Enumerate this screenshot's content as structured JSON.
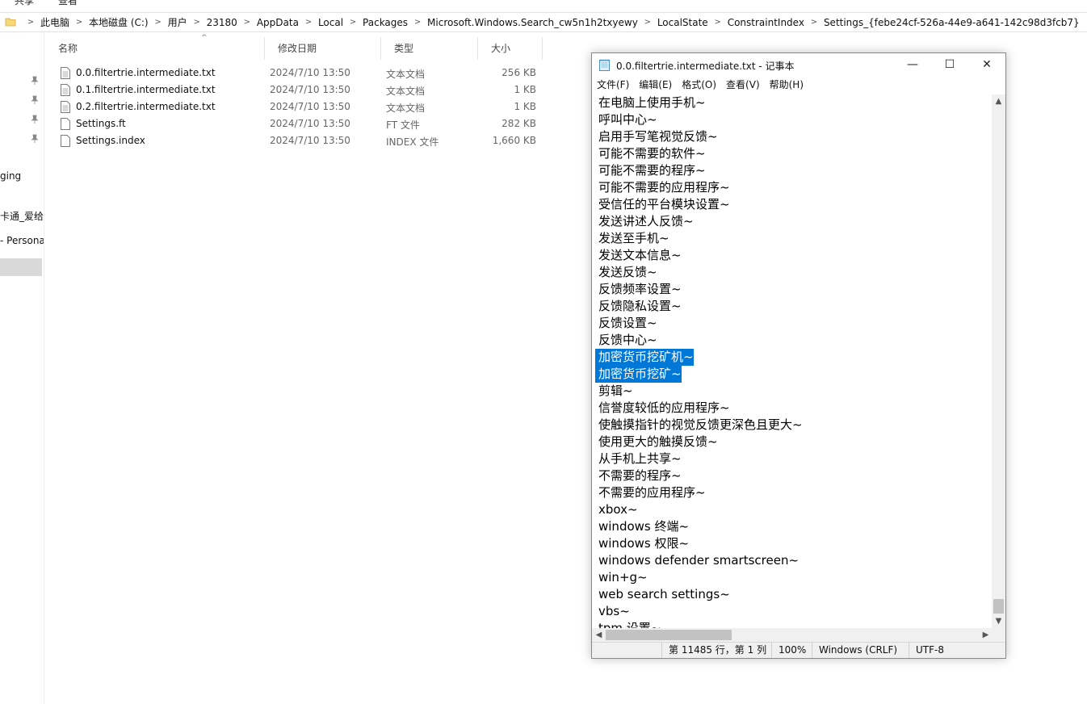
{
  "explorer": {
    "ribbon_tabs": [
      "共享",
      "查看"
    ],
    "breadcrumb": [
      "此电脑",
      "本地磁盘 (C:)",
      "用户",
      "23180",
      "AppData",
      "Local",
      "Packages",
      "Microsoft.Windows.Search_cw5n1h2txyewy",
      "LocalState",
      "ConstraintIndex",
      "Settings_{febe24cf-526a-44e9-a641-142c98d3fcb7}"
    ],
    "nav_items": [
      "ging",
      "卡通_爱给",
      "- Persona"
    ],
    "columns": {
      "name": "名称",
      "date": "修改日期",
      "type": "类型",
      "size": "大小"
    },
    "files": [
      {
        "name": "0.0.filtertrie.intermediate.txt",
        "date": "2024/7/10 13:50",
        "type": "文本文档",
        "size": "256 KB"
      },
      {
        "name": "0.1.filtertrie.intermediate.txt",
        "date": "2024/7/10 13:50",
        "type": "文本文档",
        "size": "1 KB"
      },
      {
        "name": "0.2.filtertrie.intermediate.txt",
        "date": "2024/7/10 13:50",
        "type": "文本文档",
        "size": "1 KB"
      },
      {
        "name": "Settings.ft",
        "date": "2024/7/10 13:50",
        "type": "FT 文件",
        "size": "282 KB"
      },
      {
        "name": "Settings.index",
        "date": "2024/7/10 13:50",
        "type": "INDEX 文件",
        "size": "1,660 KB"
      }
    ]
  },
  "notepad": {
    "title": "0.0.filtertrie.intermediate.txt - 记事本",
    "window_buttons": {
      "minimize": "—",
      "maximize": "☐",
      "close": "✕"
    },
    "menus": [
      "文件(F)",
      "编辑(E)",
      "格式(O)",
      "查看(V)",
      "帮助(H)"
    ],
    "lines": [
      {
        "text": "在电脑上使用手机~",
        "selected": false
      },
      {
        "text": "呼叫中心~",
        "selected": false
      },
      {
        "text": "启用手写笔视觉反馈~",
        "selected": false
      },
      {
        "text": "可能不需要的软件~",
        "selected": false
      },
      {
        "text": "可能不需要的程序~",
        "selected": false
      },
      {
        "text": "可能不需要的应用程序~",
        "selected": false
      },
      {
        "text": "受信任的平台模块设置~",
        "selected": false
      },
      {
        "text": "发送讲述人反馈~",
        "selected": false
      },
      {
        "text": "发送至手机~",
        "selected": false
      },
      {
        "text": "发送文本信息~",
        "selected": false
      },
      {
        "text": "发送反馈~",
        "selected": false
      },
      {
        "text": "反馈频率设置~",
        "selected": false
      },
      {
        "text": "反馈隐私设置~",
        "selected": false
      },
      {
        "text": "反馈设置~",
        "selected": false
      },
      {
        "text": "反馈中心~",
        "selected": false
      },
      {
        "text": "加密货币挖矿机~",
        "selected": true
      },
      {
        "text": "加密货币挖矿~",
        "selected": true
      },
      {
        "text": "剪辑~",
        "selected": false
      },
      {
        "text": "信誉度较低的应用程序~",
        "selected": false
      },
      {
        "text": "使触摸指针的视觉反馈更深色且更大~",
        "selected": false
      },
      {
        "text": "使用更大的触摸反馈~",
        "selected": false
      },
      {
        "text": "从手机上共享~",
        "selected": false
      },
      {
        "text": "不需要的程序~",
        "selected": false
      },
      {
        "text": "不需要的应用程序~",
        "selected": false
      },
      {
        "text": "xbox~",
        "selected": false
      },
      {
        "text": "windows 终端~",
        "selected": false
      },
      {
        "text": "windows 权限~",
        "selected": false
      },
      {
        "text": "windows defender smartscreen~",
        "selected": false
      },
      {
        "text": "win+g~",
        "selected": false
      },
      {
        "text": "web search settings~",
        "selected": false
      },
      {
        "text": "vbs~",
        "selected": false
      },
      {
        "text": "tpm 设置~",
        "selected": false
      }
    ],
    "status": {
      "position": "第 11485 行，第 1 列",
      "zoom": "100%",
      "line_ending": "Windows (CRLF)",
      "encoding": "UTF-8"
    },
    "colors": {
      "selection": "#0078d7"
    }
  }
}
